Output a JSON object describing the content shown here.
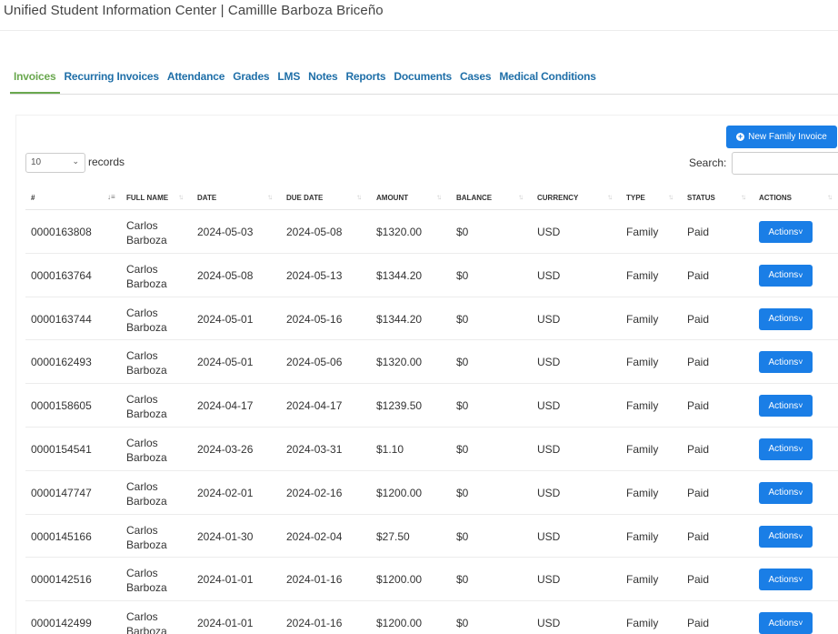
{
  "header": {
    "title": "Unified Student Information Center | Camillle Barboza Briceño"
  },
  "tabs": [
    {
      "label": "Invoices",
      "active": true
    },
    {
      "label": "Recurring Invoices"
    },
    {
      "label": "Attendance"
    },
    {
      "label": "Grades"
    },
    {
      "label": "LMS"
    },
    {
      "label": "Notes"
    },
    {
      "label": "Reports"
    },
    {
      "label": "Documents"
    },
    {
      "label": "Cases"
    },
    {
      "label": "Medical Conditions"
    }
  ],
  "toolbar": {
    "new_invoice_label": "New Family Invoice",
    "page_length": "10",
    "records_label": "records",
    "search_label": "Search:",
    "search_value": ""
  },
  "table": {
    "columns": [
      "#",
      "FULL NAME",
      "DATE",
      "DUE DATE",
      "AMOUNT",
      "BALANCE",
      "CURRENCY",
      "TYPE",
      "STATUS",
      "ACTIONS"
    ],
    "action_label": "Actions",
    "rows": [
      {
        "id": "0000163808",
        "name": "Carlos Barboza",
        "date": "2024-05-03",
        "due": "2024-05-08",
        "amount": "$1320.00",
        "balance": "$0",
        "currency": "USD",
        "type": "Family",
        "status": "Paid"
      },
      {
        "id": "0000163764",
        "name": "Carlos Barboza",
        "date": "2024-05-08",
        "due": "2024-05-13",
        "amount": "$1344.20",
        "balance": "$0",
        "currency": "USD",
        "type": "Family",
        "status": "Paid"
      },
      {
        "id": "0000163744",
        "name": "Carlos Barboza",
        "date": "2024-05-01",
        "due": "2024-05-16",
        "amount": "$1344.20",
        "balance": "$0",
        "currency": "USD",
        "type": "Family",
        "status": "Paid"
      },
      {
        "id": "0000162493",
        "name": "Carlos Barboza",
        "date": "2024-05-01",
        "due": "2024-05-06",
        "amount": "$1320.00",
        "balance": "$0",
        "currency": "USD",
        "type": "Family",
        "status": "Paid"
      },
      {
        "id": "0000158605",
        "name": "Carlos Barboza",
        "date": "2024-04-17",
        "due": "2024-04-17",
        "amount": "$1239.50",
        "balance": "$0",
        "currency": "USD",
        "type": "Family",
        "status": "Paid"
      },
      {
        "id": "0000154541",
        "name": "Carlos Barboza",
        "date": "2024-03-26",
        "due": "2024-03-31",
        "amount": "$1.10",
        "balance": "$0",
        "currency": "USD",
        "type": "Family",
        "status": "Paid"
      },
      {
        "id": "0000147747",
        "name": "Carlos Barboza",
        "date": "2024-02-01",
        "due": "2024-02-16",
        "amount": "$1200.00",
        "balance": "$0",
        "currency": "USD",
        "type": "Family",
        "status": "Paid"
      },
      {
        "id": "0000145166",
        "name": "Carlos Barboza",
        "date": "2024-01-30",
        "due": "2024-02-04",
        "amount": "$27.50",
        "balance": "$0",
        "currency": "USD",
        "type": "Family",
        "status": "Paid"
      },
      {
        "id": "0000142516",
        "name": "Carlos Barboza",
        "date": "2024-01-01",
        "due": "2024-01-16",
        "amount": "$1200.00",
        "balance": "$0",
        "currency": "USD",
        "type": "Family",
        "status": "Paid"
      },
      {
        "id": "0000142499",
        "name": "Carlos Barboza",
        "date": "2024-01-01",
        "due": "2024-01-16",
        "amount": "$1200.00",
        "balance": "$0",
        "currency": "USD",
        "type": "Family",
        "status": "Paid"
      }
    ]
  },
  "colors": {
    "accent": "#1a7ee6",
    "active_tab": "#6aa84f",
    "tab_link": "#1f6fa8"
  },
  "icons": {
    "new_invoice": "plus-circle-icon",
    "sort": "sort-arrows-icon",
    "actions": "chevron-down-icon"
  }
}
